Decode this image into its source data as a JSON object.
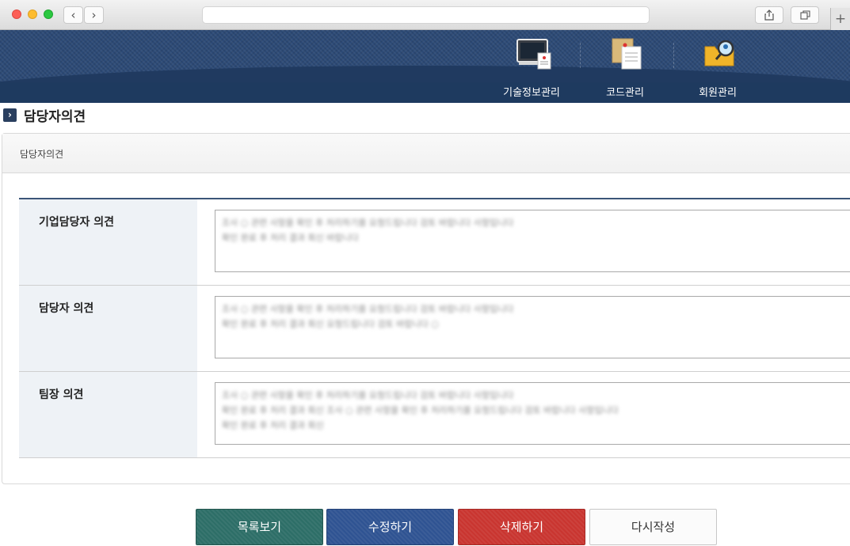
{
  "browser": {
    "back_glyph": "‹",
    "forward_glyph": "›",
    "url": "",
    "share_icon": "share-icon",
    "tabs_icon": "tabs-icon",
    "newtab_glyph": "+"
  },
  "header": {
    "menu": [
      {
        "label": "기술정보관리",
        "icon": "monitor-icon"
      },
      {
        "label": "코드관리",
        "icon": "documents-icon"
      },
      {
        "label": "회원관리",
        "icon": "folder-search-icon"
      }
    ]
  },
  "page": {
    "title": "담당자의견",
    "panel_heading": "담당자의견"
  },
  "form": {
    "rows": [
      {
        "label": "기업담당자 의견",
        "lines": [
          "조사 ○ 관련 사항을 확인 후 처리하기를 요청드립니다 검토 바랍니다 사항입니다",
          "확인 완료 후 처리 결과 회신 바랍니다"
        ]
      },
      {
        "label": "담당자 의견",
        "lines": [
          "조사 ○ 관련 사항을 확인 후 처리하기를 요청드립니다 검토 바랍니다 사항입니다",
          "확인 완료 후 처리 결과 회신 요청드립니다 검토 바랍니다 ○"
        ]
      },
      {
        "label": "팀장 의견",
        "lines": [
          "조사 ○ 관련 사항을 확인 후 처리하기를 요청드립니다 검토 바랍니다 사항입니다",
          "확인 완료 후 처리 결과 회신 조사 ○ 관련 사항을 확인 후 처리하기를 요청드립니다 검토 바랍니다 사항입니다",
          "확인 완료 후 처리 결과 회신"
        ]
      }
    ]
  },
  "buttons": {
    "list": "목록보기",
    "edit": "수정하기",
    "delete": "삭제하기",
    "rewrite": "다시작성"
  },
  "colors": {
    "header": "#2c4a76",
    "list_button": "#2d6e67",
    "edit_button": "#2f5392",
    "delete_button": "#c93530"
  }
}
